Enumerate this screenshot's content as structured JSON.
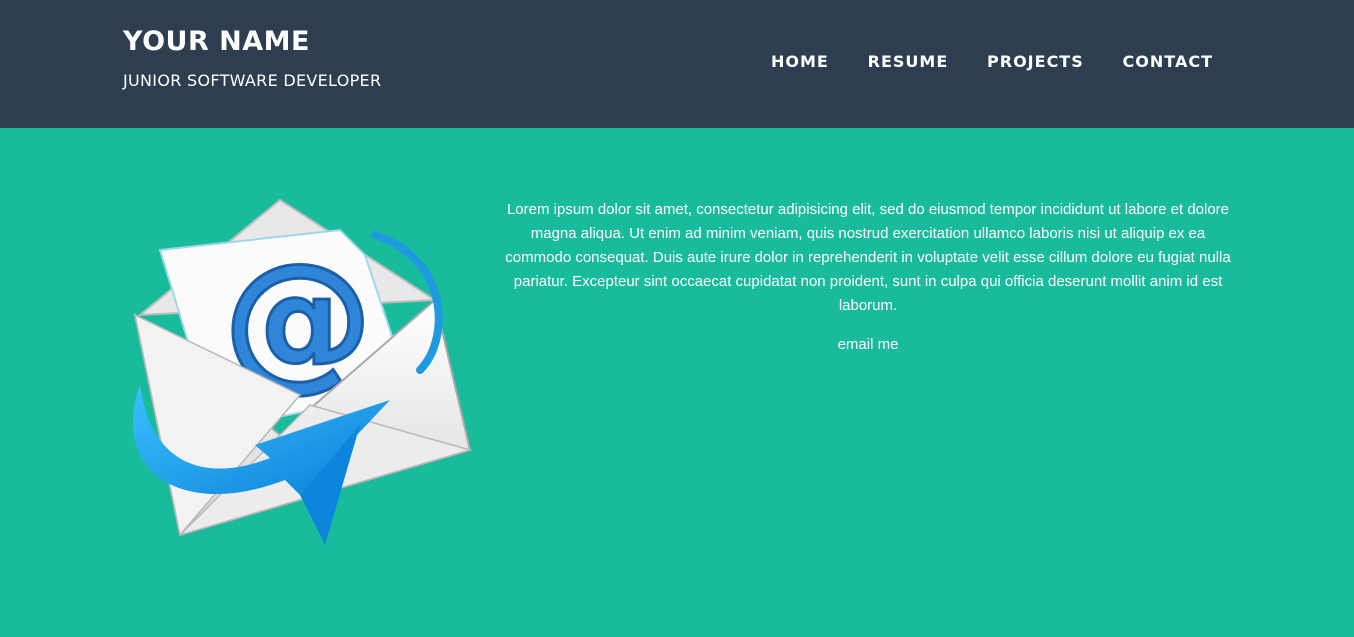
{
  "header": {
    "name": "YOUR NAME",
    "title": "JUNIOR SOFTWARE DEVELOPER",
    "nav": [
      {
        "label": "HOME"
      },
      {
        "label": "RESUME"
      },
      {
        "label": "PROJECTS"
      },
      {
        "label": "CONTACT"
      }
    ]
  },
  "main": {
    "image_icon": "email-envelope-icon",
    "image_glyph": "@",
    "about_text": "Lorem ipsum dolor sit amet, consectetur adipisicing elit, sed do eiusmod tempor incididunt ut labore et dolore magna aliqua. Ut enim ad minim veniam, quis nostrud exercitation ullamco laboris nisi ut aliquip ex ea commodo consequat. Duis aute irure dolor in reprehenderit in voluptate velit esse cillum dolore eu fugiat nulla pariatur. Excepteur sint occaecat cupidatat non proident, sunt in culpa qui officia deserunt mollit anim id est laborum.",
    "email_label": "email me"
  },
  "colors": {
    "navbar": "#2c3e50",
    "background": "#18bc9c",
    "arrow": "#1e9be0"
  }
}
